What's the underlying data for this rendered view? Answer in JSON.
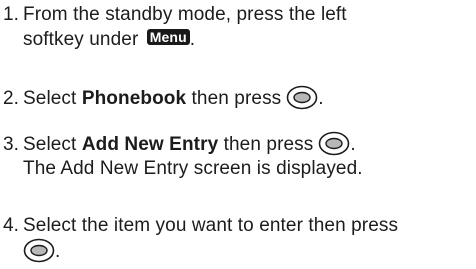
{
  "steps": [
    {
      "number": "1.",
      "line1": "From the standby mode, press the left",
      "line2": "softkey under",
      "softkey_label": "Menu",
      "line2_end": "."
    },
    {
      "number": "2.",
      "pre": "Select",
      "bold": "Phonebook",
      "post": "then press",
      "end": ".",
      "icon": "ok-button-icon"
    },
    {
      "number": "3.",
      "pre": "Select",
      "bold": "Add New Entry",
      "post": "then press",
      "end": ".",
      "line2": "The Add New Entry screen is displayed.",
      "icon": "ok-button-icon"
    },
    {
      "number": "4.",
      "line1": "Select the item you want to enter then press",
      "end": ".",
      "icon": "ok-button-icon"
    }
  ]
}
